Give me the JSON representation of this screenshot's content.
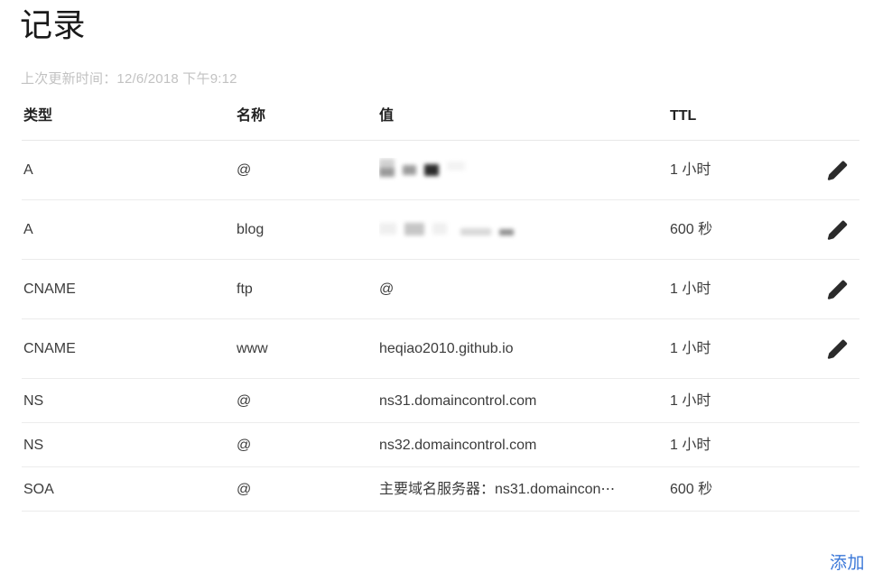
{
  "page": {
    "title": "记录",
    "last_updated": "上次更新时间：12/6/2018 下午9:12"
  },
  "table": {
    "columns": {
      "type": "类型",
      "name": "名称",
      "value": "值",
      "ttl": "TTL"
    },
    "rows": [
      {
        "type": "A",
        "name": "@",
        "value": "",
        "value_redacted": true,
        "ttl": "1 小时",
        "editable": true
      },
      {
        "type": "A",
        "name": "blog",
        "value": "",
        "value_redacted": true,
        "ttl": "600 秒",
        "editable": true
      },
      {
        "type": "CNAME",
        "name": "ftp",
        "value": "@",
        "value_redacted": false,
        "ttl": "1 小时",
        "editable": true
      },
      {
        "type": "CNAME",
        "name": "www",
        "value": "heqiao2010.github.io",
        "value_redacted": false,
        "ttl": "1 小时",
        "editable": true
      },
      {
        "type": "NS",
        "name": "@",
        "value": "ns31.domaincontrol.com",
        "value_redacted": false,
        "ttl": "1 小时",
        "editable": false
      },
      {
        "type": "NS",
        "name": "@",
        "value": "ns32.domaincontrol.com",
        "value_redacted": false,
        "ttl": "1 小时",
        "editable": false
      },
      {
        "type": "SOA",
        "name": "@",
        "value": "主要域名服务器：ns31.domaincon⋯",
        "value_redacted": false,
        "ttl": "600 秒",
        "editable": false
      }
    ]
  },
  "footer": {
    "add_label": "添加"
  },
  "colors": {
    "accent": "#3b78d8",
    "text": "#3c3c3c",
    "muted": "#c2c2c2",
    "divider": "#ececec"
  },
  "icons": {
    "edit": "pencil-icon"
  }
}
